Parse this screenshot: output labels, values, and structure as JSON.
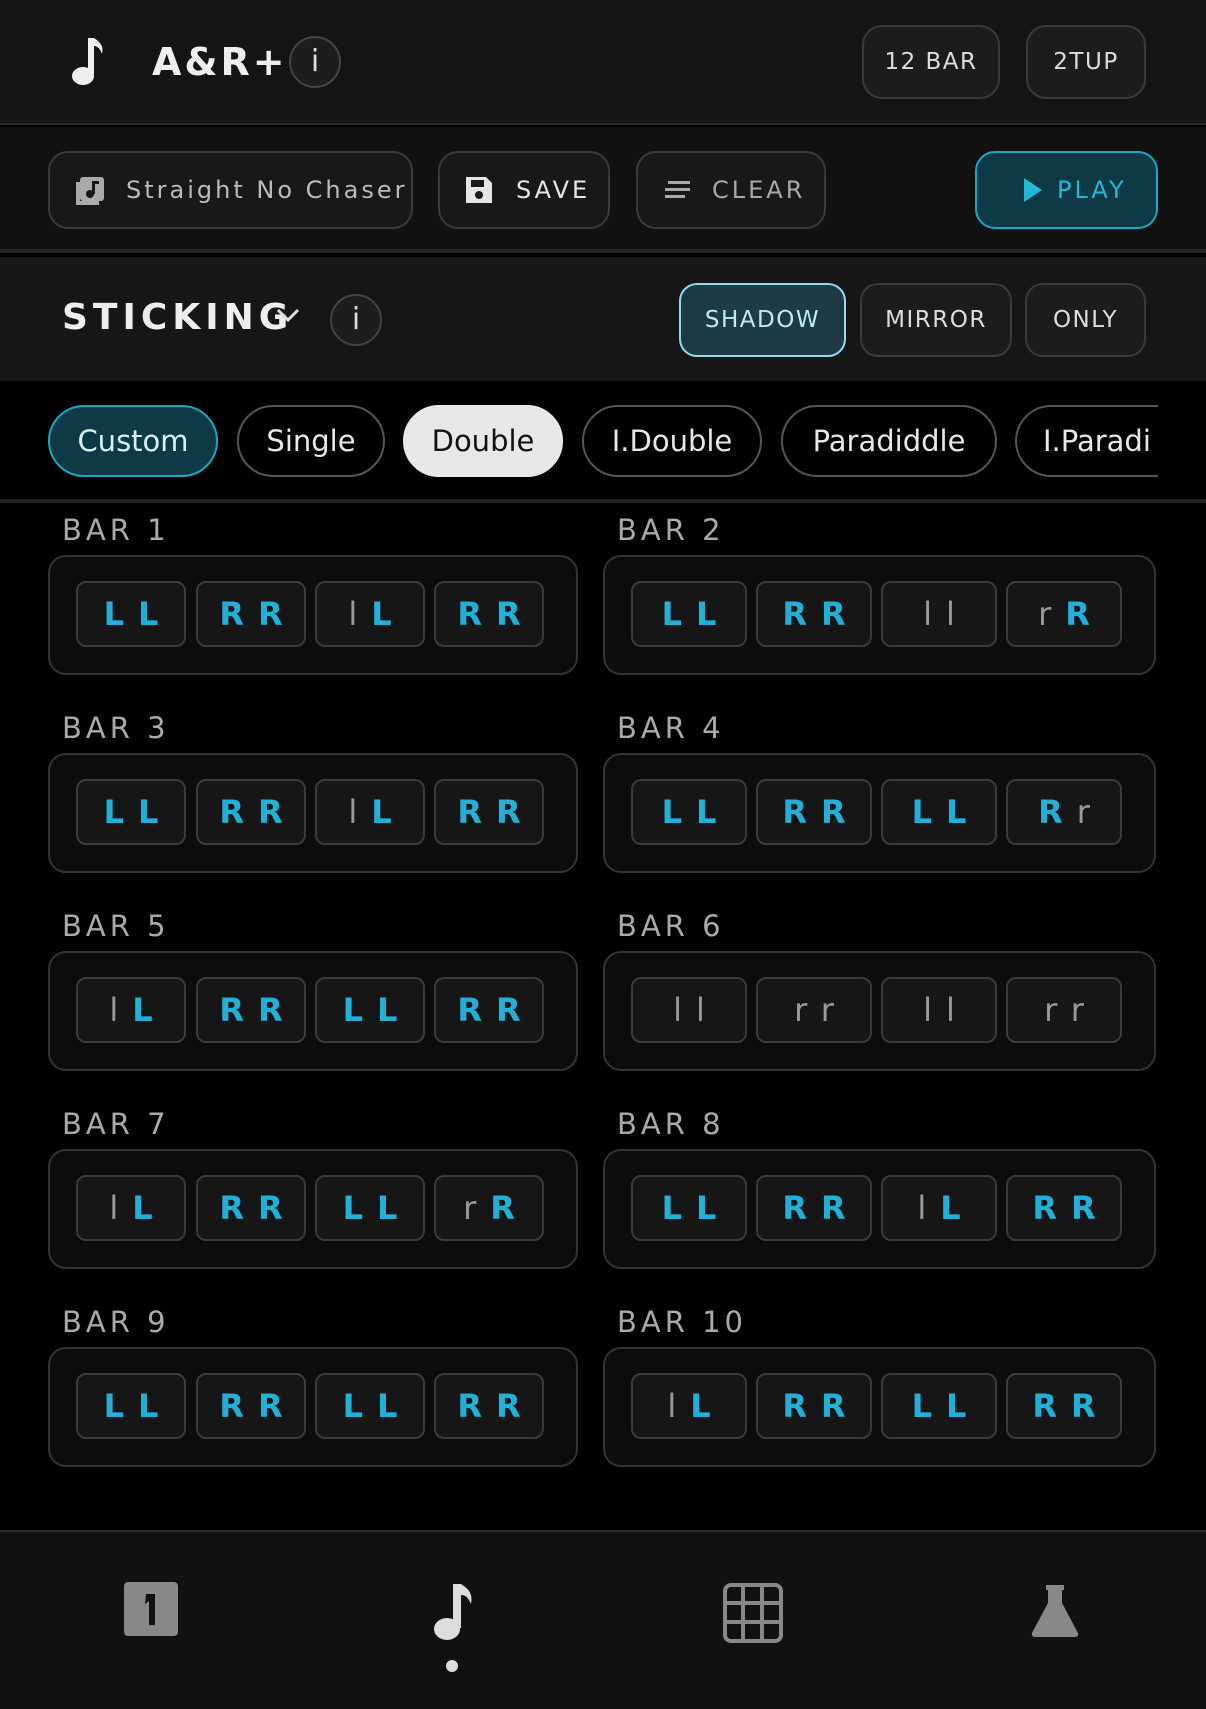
{
  "header": {
    "title": "A&R+",
    "info": "i",
    "bar_button": "12 BAR",
    "tup_button": "2TUP"
  },
  "toolbar": {
    "song": "Straight No Chaser",
    "save": "SAVE",
    "clear": "CLEAR",
    "play": "PLAY"
  },
  "sticking": {
    "label": "STICKING",
    "info": "i",
    "modes": [
      "SHADOW",
      "MIRROR",
      "ONLY"
    ],
    "active_mode": "SHADOW"
  },
  "patterns": {
    "items": [
      "Custom",
      "Single",
      "Double",
      "I.Double",
      "Paradiddle",
      "I.Paradi"
    ],
    "selected": "Double",
    "custom_highlight": "Custom"
  },
  "bars": [
    {
      "label": "BAR 1",
      "beats": [
        [
          "L",
          "L"
        ],
        [
          "R",
          "R"
        ],
        [
          "l",
          "L"
        ],
        [
          "R",
          "R"
        ]
      ]
    },
    {
      "label": "BAR 2",
      "beats": [
        [
          "L",
          "L"
        ],
        [
          "R",
          "R"
        ],
        [
          "l",
          "l"
        ],
        [
          "r",
          "R"
        ]
      ]
    },
    {
      "label": "BAR 3",
      "beats": [
        [
          "L",
          "L"
        ],
        [
          "R",
          "R"
        ],
        [
          "l",
          "L"
        ],
        [
          "R",
          "R"
        ]
      ]
    },
    {
      "label": "BAR 4",
      "beats": [
        [
          "L",
          "L"
        ],
        [
          "R",
          "R"
        ],
        [
          "L",
          "L"
        ],
        [
          "R",
          "r"
        ]
      ]
    },
    {
      "label": "BAR 5",
      "beats": [
        [
          "l",
          "L"
        ],
        [
          "R",
          "R"
        ],
        [
          "L",
          "L"
        ],
        [
          "R",
          "R"
        ]
      ]
    },
    {
      "label": "BAR 6",
      "beats": [
        [
          "l",
          "l"
        ],
        [
          "r",
          "r"
        ],
        [
          "l",
          "l"
        ],
        [
          "r",
          "r"
        ]
      ]
    },
    {
      "label": "BAR 7",
      "beats": [
        [
          "l",
          "L"
        ],
        [
          "R",
          "R"
        ],
        [
          "L",
          "L"
        ],
        [
          "r",
          "R"
        ]
      ]
    },
    {
      "label": "BAR 8",
      "beats": [
        [
          "L",
          "L"
        ],
        [
          "R",
          "R"
        ],
        [
          "l",
          "L"
        ],
        [
          "R",
          "R"
        ]
      ]
    },
    {
      "label": "BAR 9",
      "beats": [
        [
          "L",
          "L"
        ],
        [
          "R",
          "R"
        ],
        [
          "L",
          "L"
        ],
        [
          "R",
          "R"
        ]
      ]
    },
    {
      "label": "BAR 10",
      "beats": [
        [
          "l",
          "L"
        ],
        [
          "R",
          "R"
        ],
        [
          "L",
          "L"
        ],
        [
          "R",
          "R"
        ]
      ]
    }
  ],
  "nav": {
    "items": [
      "counter-icon",
      "note-icon",
      "grid-icon",
      "flask-icon"
    ],
    "active": "note-icon"
  },
  "colors": {
    "accent": "#23b0d8",
    "accent_bg": "#0d3a45",
    "shadow_active": "#8fdcf0",
    "muted": "#999999"
  }
}
